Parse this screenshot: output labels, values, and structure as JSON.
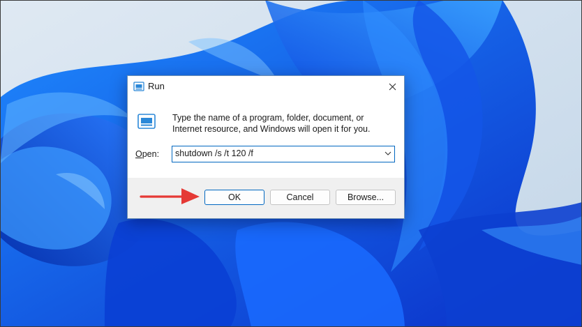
{
  "dialog": {
    "title": "Run",
    "description": "Type the name of a program, folder, document, or Internet resource, and Windows will open it for you.",
    "open_label_accel": "O",
    "open_label_rest": "pen:",
    "open_value": "shutdown /s /t 120 /f",
    "buttons": {
      "ok": "OK",
      "cancel": "Cancel",
      "browse": "Browse..."
    }
  },
  "colors": {
    "accent": "#0067c0",
    "annotation_arrow": "#e53935",
    "button_strip": "#f0f0f0"
  },
  "icons": {
    "title": "run-app-icon",
    "content": "run-app-icon",
    "close": "close-icon",
    "dropdown": "chevron-down-icon",
    "annotation": "red-arrow-icon"
  }
}
